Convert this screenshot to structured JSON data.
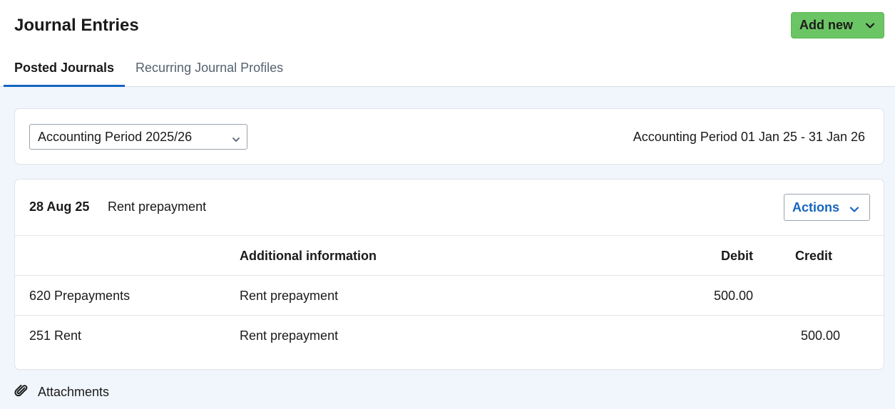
{
  "header": {
    "title": "Journal Entries",
    "add_new_label": "Add new",
    "tabs": [
      {
        "label": "Posted Journals",
        "active": true
      },
      {
        "label": "Recurring Journal Profiles",
        "active": false
      }
    ]
  },
  "period": {
    "selected": "Accounting Period 2025/26",
    "range": "Accounting Period 01 Jan 25 - 31 Jan 26"
  },
  "journal": {
    "date": "28 Aug 25",
    "description": "Rent prepayment",
    "actions_label": "Actions",
    "columns": {
      "account": "",
      "info": "Additional information",
      "debit": "Debit",
      "credit": "Credit"
    },
    "rows": [
      {
        "account": "620 Prepayments",
        "info": "Rent prepayment",
        "debit": "500.00",
        "credit": ""
      },
      {
        "account": "251 Rent",
        "info": "Rent prepayment",
        "debit": "",
        "credit": "500.00"
      }
    ]
  },
  "attachments": {
    "label": "Attachments",
    "icon": "paperclip-icon"
  },
  "colors": {
    "accent_green": "#6cc564",
    "link_blue": "#1565c0",
    "background": "#f1f6fd"
  }
}
